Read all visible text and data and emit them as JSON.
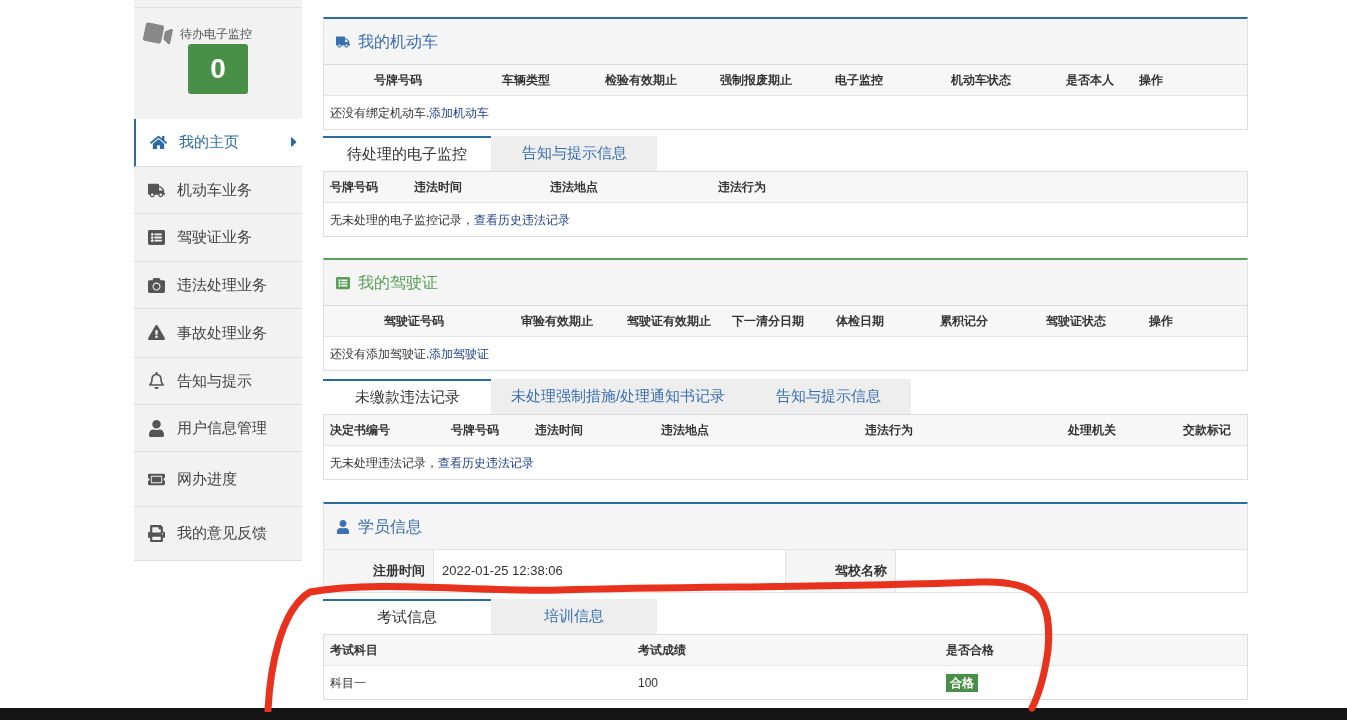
{
  "sidebar": {
    "monitor": {
      "label": "待办电子监控",
      "count": "0"
    },
    "items": [
      {
        "label": "我的主页",
        "selected": true
      },
      {
        "label": "机动车业务",
        "selected": false
      },
      {
        "label": "驾驶证业务",
        "selected": false
      },
      {
        "label": "违法处理业务",
        "selected": false
      },
      {
        "label": "事故处理业务",
        "selected": false
      },
      {
        "label": "告知与提示",
        "selected": false
      },
      {
        "label": "用户信息管理",
        "selected": false
      },
      {
        "label": "网办进度",
        "selected": false
      },
      {
        "label": "我的意见反馈",
        "selected": false
      }
    ]
  },
  "vehicles": {
    "title": "我的机动车",
    "columns": [
      "号牌号码",
      "车辆类型",
      "检验有效期止",
      "强制报废期止",
      "电子监控",
      "机动车状态",
      "是否本人",
      "操作"
    ],
    "empty_text": "还没有绑定机动车.",
    "link": "添加机动车"
  },
  "vehicle_tabs": {
    "tabs": [
      {
        "label": "待处理的电子监控",
        "selected": true
      },
      {
        "label": "告知与提示信息",
        "selected": false
      }
    ],
    "columns": [
      "号牌号码",
      "违法时间",
      "违法地点",
      "违法行为"
    ],
    "empty_text": "无未处理的电子监控记录，",
    "link": "查看历史违法记录"
  },
  "licenses": {
    "title": "我的驾驶证",
    "columns": [
      "驾驶证号码",
      "审验有效期止",
      "驾驶证有效期止",
      "下一清分日期",
      "体检日期",
      "累积记分",
      "驾驶证状态",
      "操作"
    ],
    "empty_text": "还没有添加驾驶证.",
    "link": "添加驾驶证"
  },
  "violation_tabs": {
    "tabs": [
      {
        "label": "未缴款违法记录",
        "selected": true
      },
      {
        "label": "未处理强制措施/处理通知书记录",
        "selected": false
      },
      {
        "label": "告知与提示信息",
        "selected": false
      }
    ],
    "columns": [
      "决定书编号",
      "号牌号码",
      "违法时间",
      "违法地点",
      "违法行为",
      "处理机关",
      "交款标记"
    ],
    "empty_text": "无未处理违法记录，",
    "link": "查看历史违法记录"
  },
  "student": {
    "title": "学员信息",
    "fields": [
      {
        "label": "注册时间",
        "value": "2022-01-25 12:38:06"
      },
      {
        "label": "驾校名称"
      }
    ]
  },
  "exam_tabs": {
    "tabs": [
      {
        "label": "考试信息",
        "selected": true
      },
      {
        "label": "培训信息",
        "selected": false
      }
    ],
    "columns": [
      "考试科目",
      "考试成绩",
      "是否合格"
    ],
    "rows": [
      {
        "subject": "科目一",
        "score": "100",
        "result": "合格",
        "passed": true
      }
    ]
  }
}
